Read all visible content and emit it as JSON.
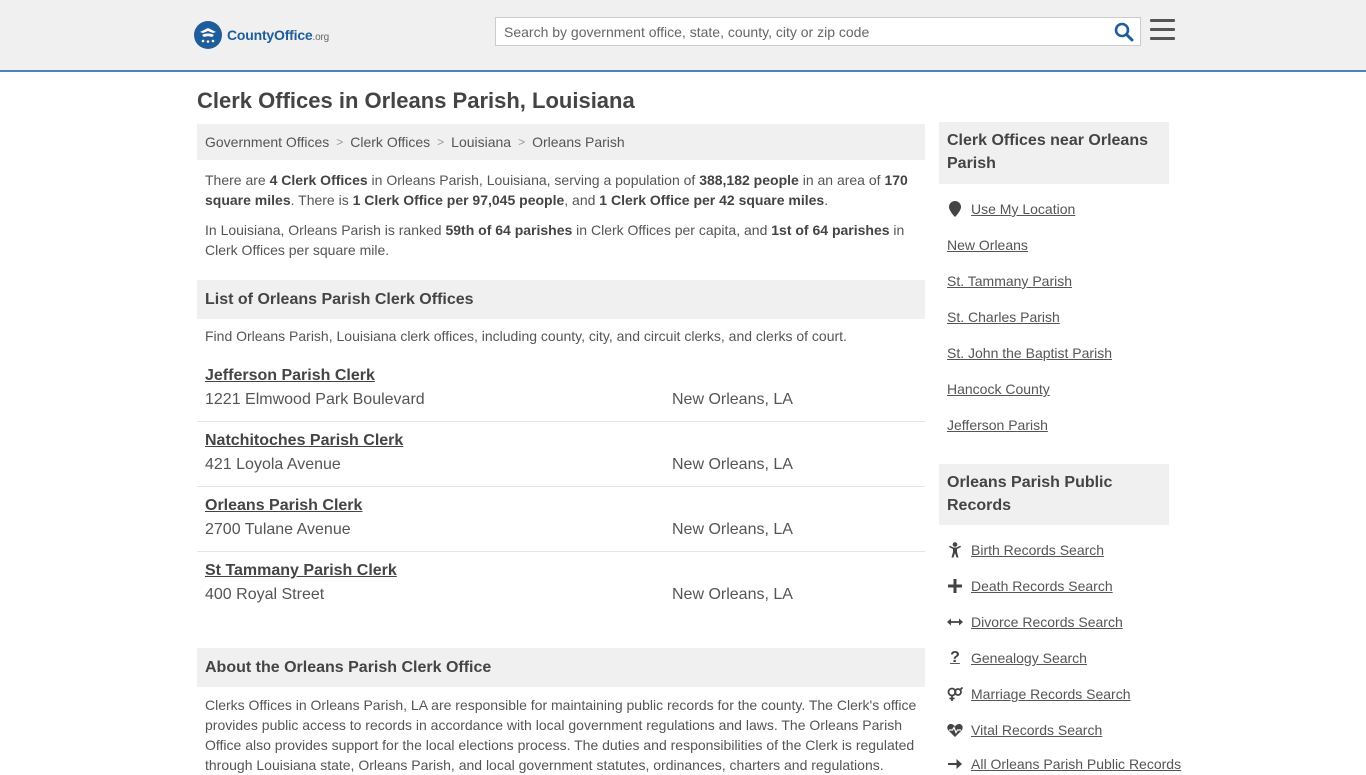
{
  "header": {
    "logo_brand": "CountyOffice",
    "logo_tld": ".org",
    "search_placeholder": "Search by government office, state, county, city or zip code"
  },
  "page_title": "Clerk Offices in Orleans Parish, Louisiana",
  "breadcrumb": [
    "Government Offices",
    "Clerk Offices",
    "Louisiana",
    "Orleans Parish"
  ],
  "intro": {
    "p1": [
      {
        "t": "There are ",
        "b": false
      },
      {
        "t": "4 Clerk Offices",
        "b": true
      },
      {
        "t": " in Orleans Parish, Louisiana, serving a population of ",
        "b": false
      },
      {
        "t": "388,182 people",
        "b": true
      },
      {
        "t": " in an area of ",
        "b": false
      },
      {
        "t": "170 square miles",
        "b": true
      },
      {
        "t": ". There is ",
        "b": false
      },
      {
        "t": "1 Clerk Office per 97,045 people",
        "b": true
      },
      {
        "t": ", and ",
        "b": false
      },
      {
        "t": "1 Clerk Office per 42 square miles",
        "b": true
      },
      {
        "t": ".",
        "b": false
      }
    ],
    "p2": [
      {
        "t": "In Louisiana, Orleans Parish is ranked ",
        "b": false
      },
      {
        "t": "59th of 64 parishes",
        "b": true
      },
      {
        "t": " in Clerk Offices per capita, and ",
        "b": false
      },
      {
        "t": "1st of 64 parishes",
        "b": true
      },
      {
        "t": " in Clerk Offices per square mile.",
        "b": false
      }
    ]
  },
  "list_section": {
    "heading": "List of Orleans Parish Clerk Offices",
    "description": "Find Orleans Parish, Louisiana clerk offices, including county, city, and circuit clerks, and clerks of court."
  },
  "offices": [
    {
      "name": "Jefferson Parish Clerk",
      "address": "1221 Elmwood Park Boulevard",
      "city": "New Orleans, LA"
    },
    {
      "name": "Natchitoches Parish Clerk",
      "address": "421 Loyola Avenue",
      "city": "New Orleans, LA"
    },
    {
      "name": "Orleans Parish Clerk",
      "address": "2700 Tulane Avenue",
      "city": "New Orleans, LA"
    },
    {
      "name": "St Tammany Parish Clerk",
      "address": "400 Royal Street",
      "city": "New Orleans, LA"
    }
  ],
  "about_section": {
    "heading": "About the Orleans Parish Clerk Office",
    "text": "Clerks Offices in Orleans Parish, LA are responsible for maintaining public records for the county. The Clerk's office provides public access to records in accordance with local government regulations and laws. The Orleans Parish Office also provides support for the local elections process. The duties and responsibilities of the Clerk is regulated through Louisiana state, Orleans Parish, and local government statutes, ordinances, charters and regulations."
  },
  "sidebar": {
    "nearby_heading": "Clerk Offices near Orleans Parish",
    "nearby_links": [
      {
        "label": "Use My Location",
        "icon": "map-pin-icon"
      },
      {
        "label": "New Orleans"
      },
      {
        "label": "St. Tammany Parish"
      },
      {
        "label": "St. Charles Parish"
      },
      {
        "label": "St. John the Baptist Parish"
      },
      {
        "label": "Hancock County"
      },
      {
        "label": "Jefferson Parish"
      }
    ],
    "records_heading": "Orleans Parish Public Records",
    "records_links": [
      {
        "label": "Birth Records Search",
        "icon": "child-icon"
      },
      {
        "label": "Death Records Search",
        "icon": "cross-icon"
      },
      {
        "label": "Divorce Records Search",
        "icon": "arrows-split-icon"
      },
      {
        "label": "Genealogy Search",
        "icon": "question-icon"
      },
      {
        "label": "Marriage Records Search",
        "icon": "gender-icon"
      },
      {
        "label": "Vital Records Search",
        "icon": "heartbeat-icon"
      },
      {
        "label": "All Orleans Parish Public Records",
        "icon": "arrow-right-icon"
      }
    ]
  },
  "colors": {
    "brand": "#1f5c9b",
    "header_bg": "#f0f0f0",
    "header_border": "#4b82c0"
  }
}
